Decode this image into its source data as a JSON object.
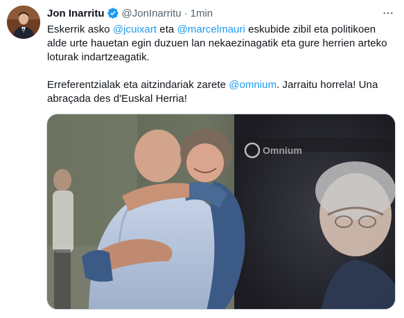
{
  "author": {
    "name": "Jon Inarritu",
    "handle": "@JonInarritu",
    "time": "1min",
    "separator": "·"
  },
  "tweet": {
    "line1_prefix": "Eskerrik asko ",
    "mention1": "@jcuixart",
    "line1_mid": " eta ",
    "mention2": "@marcelmauri",
    "line1_suffix": " eskubide zibil eta politikoen alde urte hauetan egin duzuen lan nekaezinagatik eta gure herrien arteko loturak indartzeagatik.",
    "line2_prefix": "Erreferentzialak eta aitzindariak zarete ",
    "mention3": "@omnium",
    "line2_suffix": ". Jarraitu horrela! Una abraçada des d'Euskal Herria!"
  },
  "media": {
    "banner_text": "Omnium"
  },
  "icons": {
    "verified": "verified-badge-icon",
    "more": "more-options-icon"
  },
  "colors": {
    "accent": "#1d9bf0",
    "secondary_text": "#536471"
  }
}
